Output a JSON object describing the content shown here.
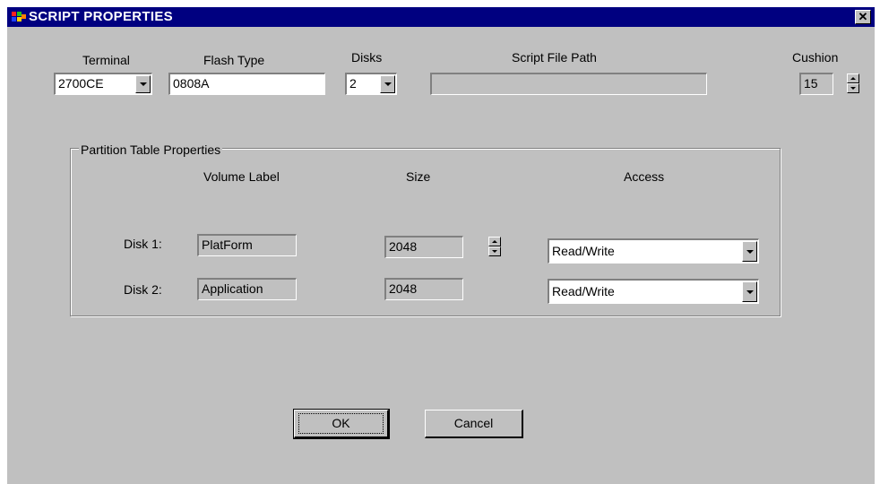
{
  "window": {
    "title": "SCRIPT PROPERTIES",
    "close_glyph": "✕"
  },
  "top": {
    "terminal": {
      "label": "Terminal",
      "value": "2700CE"
    },
    "flash_type": {
      "label": "Flash Type",
      "value": "0808A"
    },
    "disks": {
      "label": "Disks",
      "value": "2"
    },
    "script_file_path": {
      "label": "Script File Path",
      "value": ""
    },
    "cushion": {
      "label": "Cushion",
      "value": "15"
    }
  },
  "partition": {
    "title": "Partition Table Properties",
    "headers": {
      "volume_label": "Volume Label",
      "size": "Size",
      "access": "Access"
    },
    "rows": [
      {
        "label": "Disk 1:",
        "volume": "PlatForm",
        "size": "2048",
        "access": "Read/Write"
      },
      {
        "label": "Disk 2:",
        "volume": "Application",
        "size": "2048",
        "access": "Read/Write"
      }
    ]
  },
  "buttons": {
    "ok": "OK",
    "cancel": "Cancel"
  },
  "colors": {
    "titlebar": "#000080",
    "face": "#c0c0c0"
  }
}
